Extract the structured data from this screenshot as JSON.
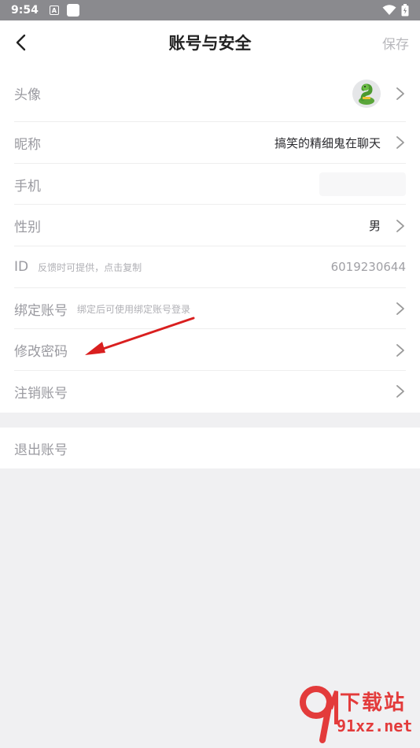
{
  "status_bar": {
    "time": "9:54",
    "notif_label": "A"
  },
  "header": {
    "title": "账号与安全",
    "save_label": "保存"
  },
  "rows": [
    {
      "label": "头像"
    },
    {
      "label": "昵称",
      "value": "搞笑的精细鬼在聊天"
    },
    {
      "label": "手机"
    },
    {
      "label": "性别",
      "value": "男"
    },
    {
      "label": "ID",
      "hint": "反馈时可提供，点击复制",
      "value": "6019230644"
    },
    {
      "label": "绑定账号",
      "hint": "绑定后可使用绑定账号登录"
    },
    {
      "label": "修改密码"
    },
    {
      "label": "注销账号"
    }
  ],
  "logout_label": "退出账号",
  "watermark": {
    "cn": "下载站",
    "en": "91xz.net"
  },
  "colors": {
    "accent_red": "#e33b3b",
    "text_label": "#9a9aa0",
    "background": "#f0f0f2"
  }
}
